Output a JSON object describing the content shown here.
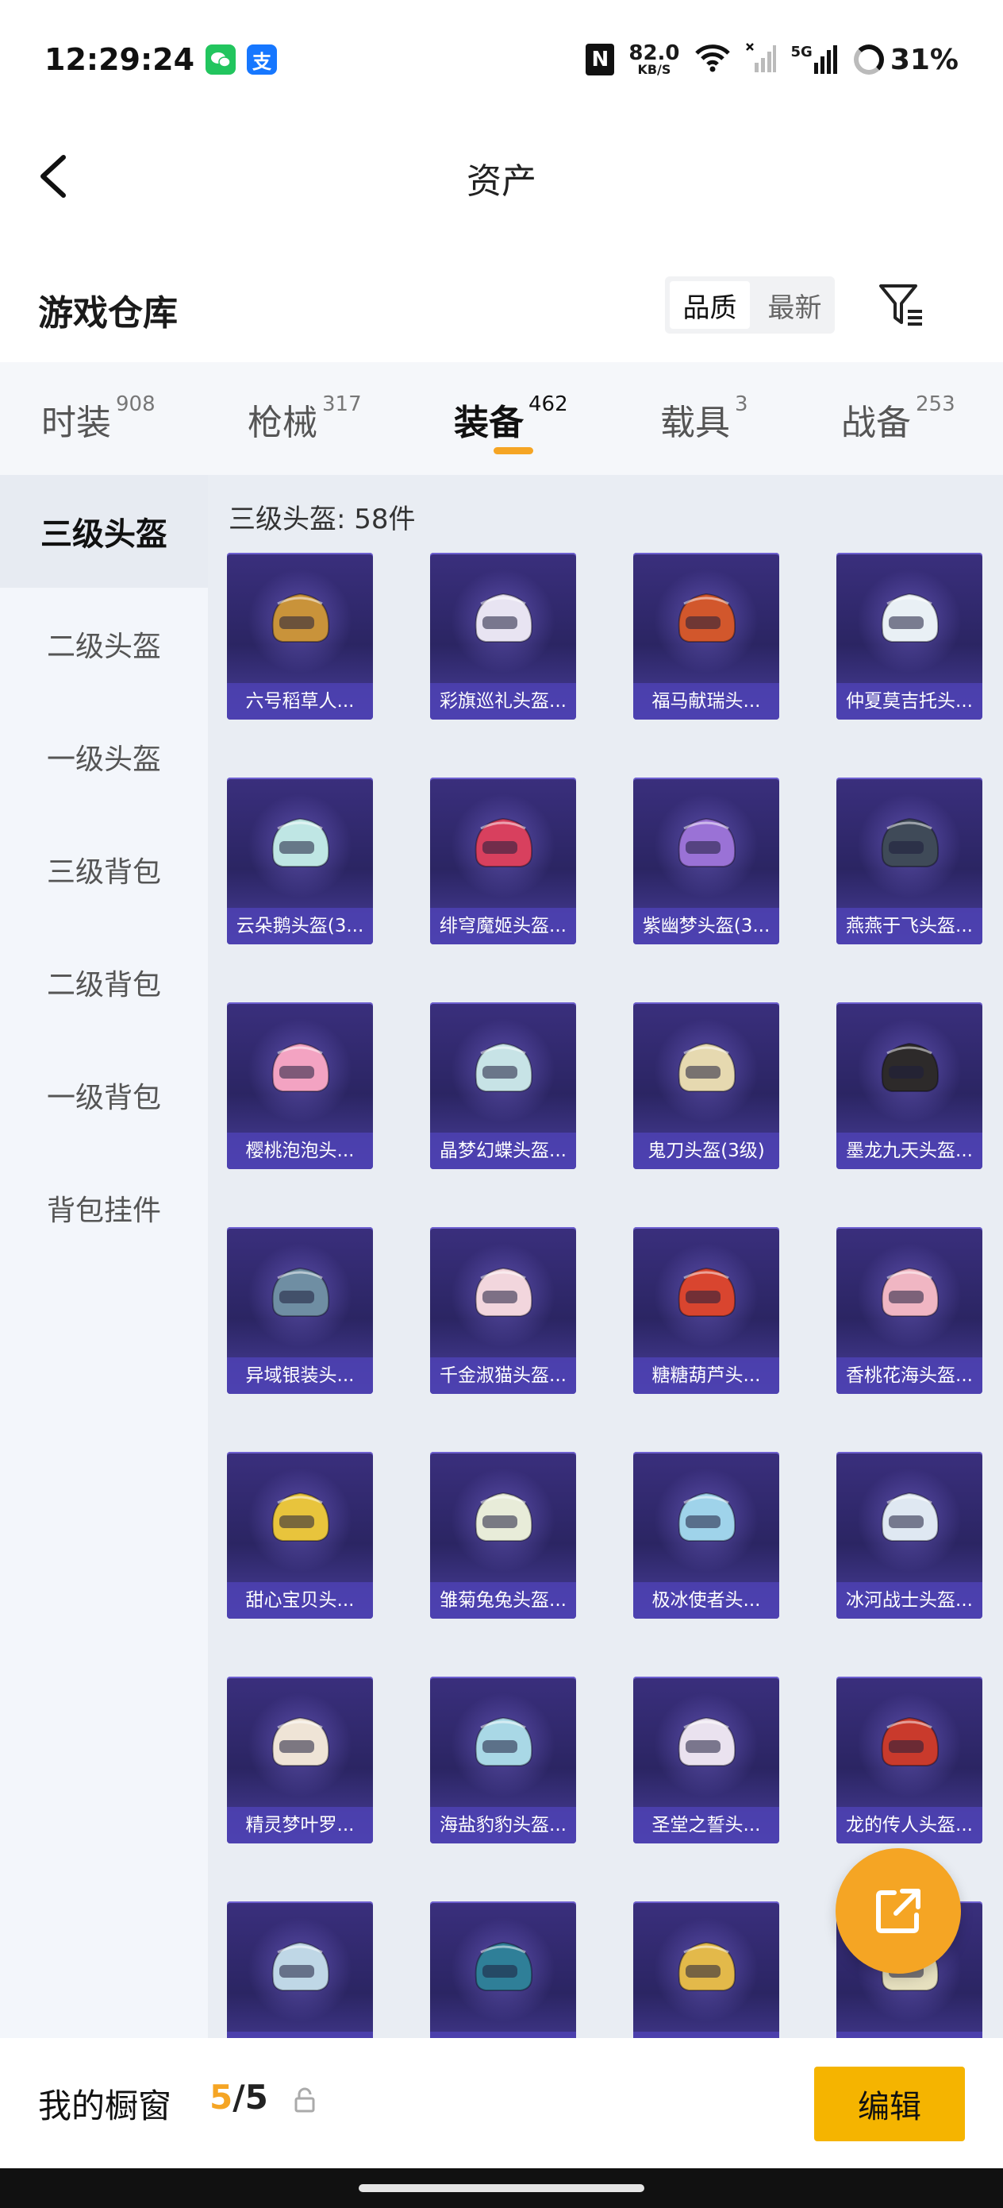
{
  "status_bar": {
    "time": "12:29:24",
    "wechat_icon": "wechat-icon",
    "alipay_glyph": "支",
    "nfc_glyph": "N",
    "net_speed": "82.0",
    "net_speed_unit": "KB/S",
    "signal_label": "5G",
    "battery": "31%"
  },
  "nav": {
    "title": "资产"
  },
  "warehouse": {
    "title": "游戏仓库",
    "sort_options": [
      "品质",
      "最新"
    ],
    "sort_selected": "品质"
  },
  "categories": [
    {
      "label": "时装",
      "count": "908"
    },
    {
      "label": "枪械",
      "count": "317"
    },
    {
      "label": "装备",
      "count": "462"
    },
    {
      "label": "载具",
      "count": "3"
    },
    {
      "label": "战备",
      "count": "253"
    }
  ],
  "active_category": "装备",
  "sidebar": {
    "items": [
      "三级头盔",
      "二级头盔",
      "一级头盔",
      "三级背包",
      "二级背包",
      "一级背包",
      "背包挂件"
    ],
    "active": "三级头盔"
  },
  "content": {
    "section_title": "三级头盔: 58件",
    "items": [
      {
        "name": "六号稻草人...",
        "color": "#c9933a"
      },
      {
        "name": "彩旗巡礼头盔...",
        "color": "#e8e4f2"
      },
      {
        "name": "福马献瑞头...",
        "color": "#d2572c"
      },
      {
        "name": "仲夏莫吉托头...",
        "color": "#e9f0f5"
      },
      {
        "name": "云朵鹅头盔(3...",
        "color": "#bfe6e4"
      },
      {
        "name": "绯穹魔姬头盔...",
        "color": "#d8405e"
      },
      {
        "name": "紫幽梦头盔(3...",
        "color": "#9a72d6"
      },
      {
        "name": "燕燕于飞头盔...",
        "color": "#3f4a58"
      },
      {
        "name": "樱桃泡泡头...",
        "color": "#f3a3c2"
      },
      {
        "name": "晶梦幻蝶头盔...",
        "color": "#c7e3e6"
      },
      {
        "name": "鬼刀头盔(3级)",
        "color": "#e6d9b0"
      },
      {
        "name": "墨龙九天头盔...",
        "color": "#2d2a2a"
      },
      {
        "name": "异域银装头...",
        "color": "#6f8ea3"
      },
      {
        "name": "千金淑猫头盔...",
        "color": "#f2d6dd"
      },
      {
        "name": "糖糖葫芦头...",
        "color": "#d9452f"
      },
      {
        "name": "香桃花海头盔...",
        "color": "#f0b6c3"
      },
      {
        "name": "甜心宝贝头...",
        "color": "#e8c43c"
      },
      {
        "name": "雏菊兔兔头盔...",
        "color": "#e8ecd9"
      },
      {
        "name": "极冰使者头...",
        "color": "#9fd3ea"
      },
      {
        "name": "冰河战士头盔...",
        "color": "#dfe8f2"
      },
      {
        "name": "精灵梦叶罗...",
        "color": "#efe4d6"
      },
      {
        "name": "海盐豹豹头盔...",
        "color": "#a9d8e6"
      },
      {
        "name": "圣堂之誓头...",
        "color": "#eae2ef"
      },
      {
        "name": "龙的传人头盔...",
        "color": "#c93a2c"
      },
      {
        "name": "",
        "color": "#bfd7e6"
      },
      {
        "name": "",
        "color": "#2f7f98"
      },
      {
        "name": "",
        "color": "#e3b94a"
      },
      {
        "name": "",
        "color": "#e6e0bf"
      }
    ]
  },
  "showcase": {
    "label": "我的橱窗",
    "current": "5",
    "separator": "/",
    "total": "5",
    "edit_label": "编辑"
  },
  "colors": {
    "accent": "#f5a524",
    "edit_button": "#f5b400",
    "card_bg": "#2b2563",
    "card_label_bg": "#4e42b4"
  }
}
